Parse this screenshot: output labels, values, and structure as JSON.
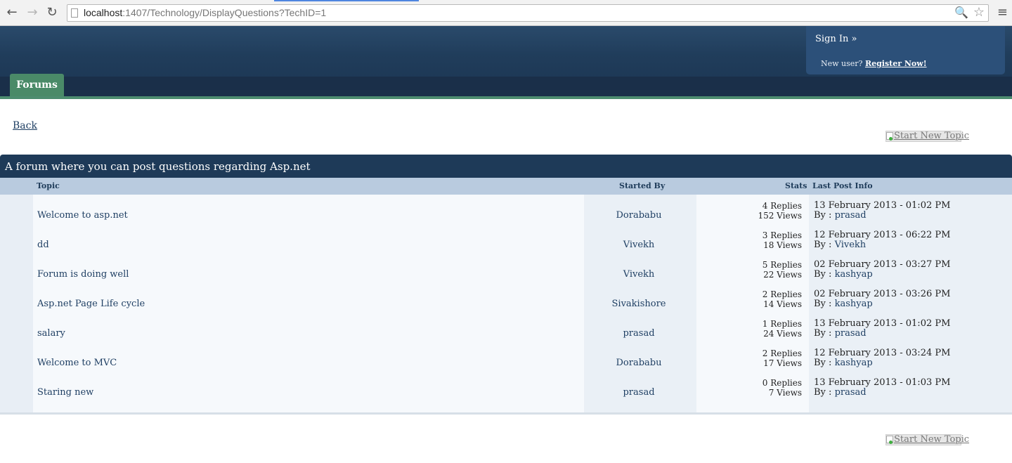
{
  "browser": {
    "url_host": "localhost",
    "url_rest": ":1407/Technology/DisplayQuestions?TechID=1",
    "back_icon": "←",
    "forward_icon": "→",
    "reload_icon": "↻",
    "search_icon": "🔍",
    "star_icon": "☆",
    "menu_icon": "≡"
  },
  "header": {
    "signin": "Sign In »",
    "new_user_text": "New user?",
    "register": "Register Now!",
    "tab_forums": "Forums"
  },
  "page": {
    "back": "Back",
    "start_new_topic": "Start New Topic",
    "forum_title": "A forum where you can post questions regarding Asp.net"
  },
  "table": {
    "headers": {
      "topic": "Topic",
      "started_by": "Started By",
      "stats": "Stats",
      "last_post": "Last Post Info"
    },
    "rows": [
      {
        "topic": "Welcome to asp.net",
        "started": "Dorababu",
        "replies": "4 Replies",
        "views": "152 Views",
        "date": "13 February 2013 - 01:02 PM",
        "by_label": "By :",
        "by_user": "prasad"
      },
      {
        "topic": "dd",
        "started": "Vivekh",
        "replies": "3 Replies",
        "views": "18 Views",
        "date": "12 February 2013 - 06:22 PM",
        "by_label": "By :",
        "by_user": "Vivekh"
      },
      {
        "topic": "Forum is doing well",
        "started": "Vivekh",
        "replies": "5 Replies",
        "views": "22 Views",
        "date": "02 February 2013 - 03:27 PM",
        "by_label": "By :",
        "by_user": "kashyap"
      },
      {
        "topic": "Asp.net Page Life cycle",
        "started": "Sivakishore",
        "replies": "2 Replies",
        "views": "14 Views",
        "date": "02 February 2013 - 03:26 PM",
        "by_label": "By :",
        "by_user": "kashyap"
      },
      {
        "topic": "salary",
        "started": "prasad",
        "replies": "1 Replies",
        "views": "24 Views",
        "date": "13 February 2013 - 01:02 PM",
        "by_label": "By :",
        "by_user": "prasad"
      },
      {
        "topic": "Welcome to MVC",
        "started": "Dorababu",
        "replies": "2 Replies",
        "views": "17 Views",
        "date": "12 February 2013 - 03:24 PM",
        "by_label": "By :",
        "by_user": "kashyap"
      },
      {
        "topic": "Staring new",
        "started": "prasad",
        "replies": "0 Replies",
        "views": "7 Views",
        "date": "13 February 2013 - 01:03 PM",
        "by_label": "By :",
        "by_user": "prasad"
      }
    ]
  }
}
